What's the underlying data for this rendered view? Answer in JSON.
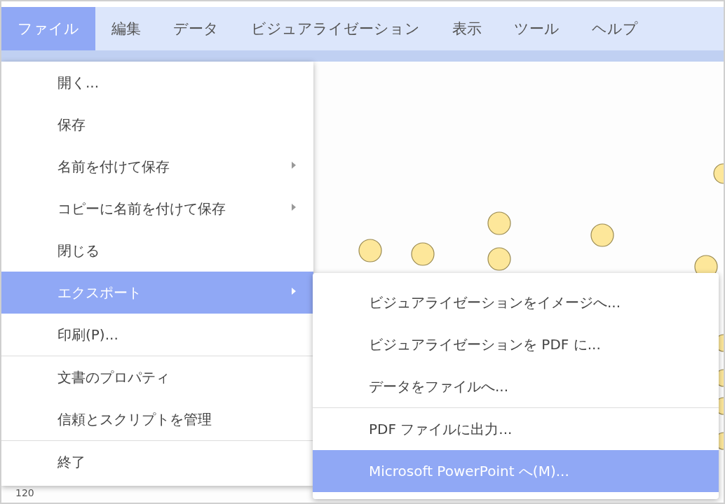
{
  "menubar": [
    {
      "label": "ファイル",
      "selected": true
    },
    {
      "label": "編集",
      "selected": false
    },
    {
      "label": "データ",
      "selected": false
    },
    {
      "label": "ビジュアライゼーション",
      "selected": false
    },
    {
      "label": "表示",
      "selected": false
    },
    {
      "label": "ツール",
      "selected": false
    },
    {
      "label": "ヘルプ",
      "selected": false
    }
  ],
  "axis_label": "120",
  "file_menu": [
    {
      "kind": "item",
      "label": "開く...",
      "selected": false,
      "has_submenu": false
    },
    {
      "kind": "item",
      "label": "保存",
      "selected": false,
      "has_submenu": false
    },
    {
      "kind": "item",
      "label": "名前を付けて保存",
      "selected": false,
      "has_submenu": true
    },
    {
      "kind": "item",
      "label": "コピーに名前を付けて保存",
      "selected": false,
      "has_submenu": true
    },
    {
      "kind": "item",
      "label": "閉じる",
      "selected": false,
      "has_submenu": false
    },
    {
      "kind": "item",
      "label": "エクスポート",
      "selected": true,
      "has_submenu": true
    },
    {
      "kind": "item",
      "label": "印刷(P)...",
      "selected": false,
      "has_submenu": false
    },
    {
      "kind": "separator"
    },
    {
      "kind": "item",
      "label": "文書のプロパティ",
      "selected": false,
      "has_submenu": false
    },
    {
      "kind": "item",
      "label": "信頼とスクリプトを管理",
      "selected": false,
      "has_submenu": false
    },
    {
      "kind": "separator"
    },
    {
      "kind": "item",
      "label": "終了",
      "selected": false,
      "has_submenu": false
    }
  ],
  "export_submenu": [
    {
      "kind": "item",
      "label": "ビジュアライゼーションをイメージへ...",
      "selected": false,
      "has_submenu": false
    },
    {
      "kind": "item",
      "label": "ビジュアライゼーションを PDF に...",
      "selected": false,
      "has_submenu": false
    },
    {
      "kind": "item",
      "label": "データをファイルへ...",
      "selected": false,
      "has_submenu": false
    },
    {
      "kind": "separator"
    },
    {
      "kind": "item",
      "label": "PDF ファイルに出力...",
      "selected": false,
      "has_submenu": false
    },
    {
      "kind": "item",
      "label": "Microsoft PowerPoint へ(M)...",
      "selected": true,
      "has_submenu": false
    }
  ]
}
